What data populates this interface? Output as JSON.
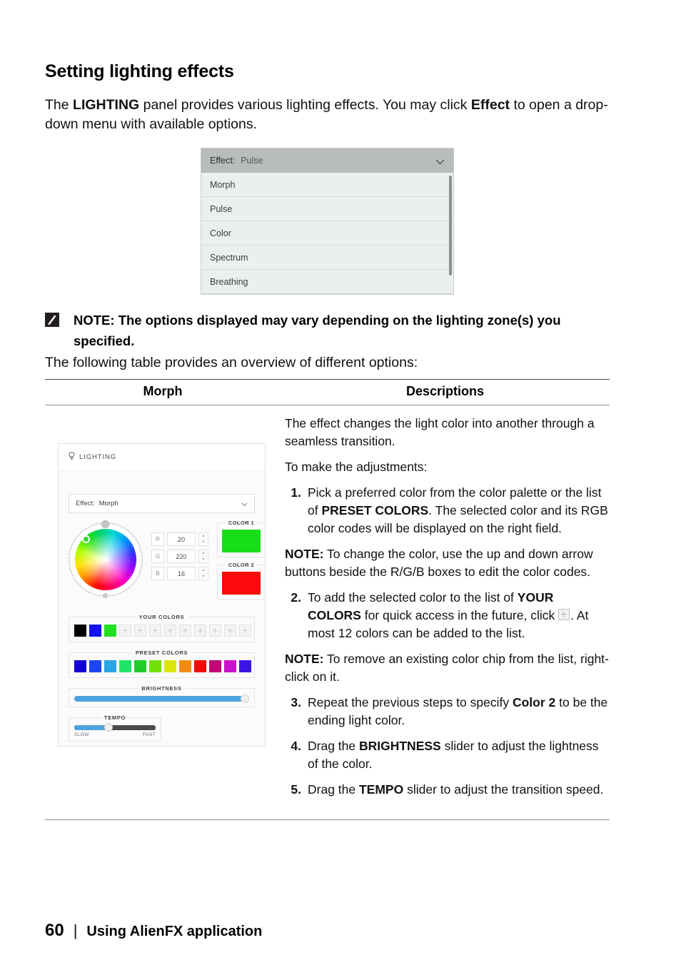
{
  "heading": "Setting lighting effects",
  "intro": {
    "part1": "The ",
    "bold1": "LIGHTING",
    "part2": " panel provides various lighting effects. You may click ",
    "bold2": "Effect",
    "part3": " to open a drop-down menu with available options."
  },
  "dropdown_shot": {
    "header_label": "Effect:",
    "header_value": "Pulse",
    "chevron_icon": "chevron-down-icon",
    "items": [
      "Morph",
      "Pulse",
      "Color",
      "Spectrum",
      "Breathing"
    ]
  },
  "note_top": {
    "icon": "note-pencil-icon",
    "text": "NOTE: The options displayed may vary depending on the lighting zone(s) you specified."
  },
  "follow_text": "The following table provides an overview of different options:",
  "table": {
    "headers": {
      "left": "Morph",
      "right": "Descriptions"
    },
    "description": {
      "para1": "The effect changes the light color into another through a seamless transition.",
      "para2": "To make the adjustments:",
      "step1": {
        "num": "1.",
        "a": "Pick a preferred color from the color palette or the list of ",
        "bold": "PRESET COLORS",
        "b": ". The selected color and its RGB color codes will be displayed on the right field."
      },
      "note1": {
        "bold": "NOTE:",
        "text": " To change the color, use the up and down arrow buttons beside the R/G/B boxes to edit the color codes."
      },
      "step2": {
        "num": "2.",
        "a": "To add the selected color to the list of ",
        "bold": "YOUR COLORS",
        "b": " for quick access in the future, click ",
        "plus_icon": "plus-icon",
        "c": ". At most 12 colors can be added to the list."
      },
      "note2": {
        "bold": "NOTE:",
        "text": " To remove an existing color chip from the list, right-click on it."
      },
      "step3": {
        "num": "3.",
        "a": "Repeat the previous steps to specify ",
        "bold": "Color 2",
        "b": " to be the ending light color."
      },
      "step4": {
        "num": "4.",
        "a": "Drag the ",
        "bold": "BRIGHTNESS",
        "b": " slider to adjust the lightness of the color."
      },
      "step5": {
        "num": "5.",
        "a": "Drag the ",
        "bold": "TEMPO",
        "b": " slider to adjust the transition speed."
      }
    }
  },
  "fx_panel": {
    "tab_label": "LIGHTING",
    "tab_icon": "lightbulb-icon",
    "effect_label": "Effect:",
    "effect_value": "Morph",
    "effect_chevron_icon": "chevron-down-icon",
    "rgb": [
      {
        "label": "R",
        "value": "20"
      },
      {
        "label": "G",
        "value": "220"
      },
      {
        "label": "B",
        "value": "16"
      }
    ],
    "color1_title": "COLOR 1",
    "color1_hex": "#18DE18",
    "color2_title": "COLOR 2",
    "color2_hex": "#FA0A0A",
    "your_colors_title": "YOUR COLORS",
    "your_colors": [
      "#000000",
      "#1313F0",
      "#22E022",
      "",
      "",
      "",
      "",
      "",
      "",
      "",
      "",
      ""
    ],
    "preset_colors_title": "PRESET COLORS",
    "preset_colors": [
      "#1400D2",
      "#1E46EE",
      "#2AA5E6",
      "#1EE468",
      "#1ECD28",
      "#73E00A",
      "#DCE60F",
      "#F08C14",
      "#F00A0A",
      "#BE0A78",
      "#CA10CA",
      "#3C14E6"
    ],
    "brightness_title": "BRIGHTNESS",
    "brightness_value": 100,
    "tempo_title": "TEMPO",
    "tempo_slow_label": "SLOW",
    "tempo_fast_label": "FAST",
    "tempo_value": 42,
    "accent_color": "#4DA3DD"
  },
  "footer": {
    "page_number": "60",
    "separator": "|",
    "text": "Using AlienFX application"
  }
}
